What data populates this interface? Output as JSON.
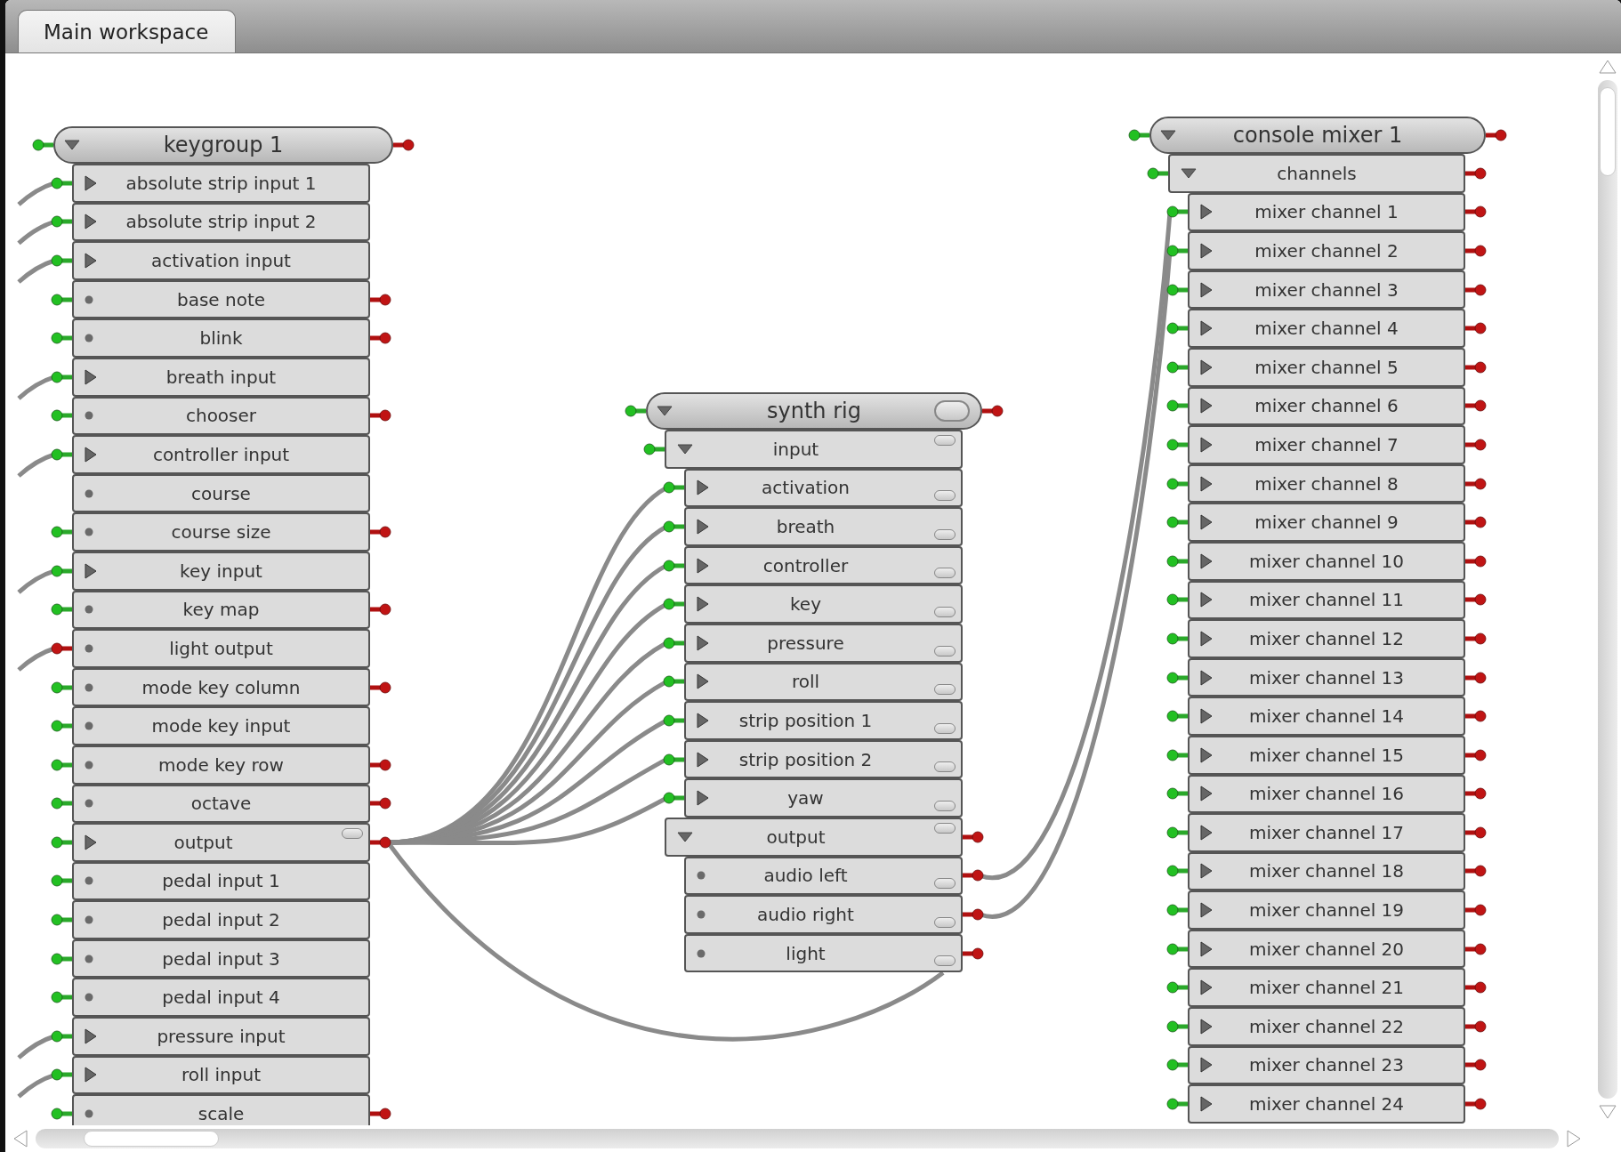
{
  "tabs": [
    {
      "label": "Main workspace",
      "selected": true
    }
  ],
  "nodes": [
    {
      "title": "keygroup 1",
      "expanded": true,
      "left_port": true,
      "right_port": true,
      "toggle_button": false,
      "rows": [
        {
          "label": "absolute strip input 1",
          "kind": "expander",
          "left_port": true,
          "left_port_red": false,
          "wired_in": true,
          "right_port": false,
          "toggle_button": false
        },
        {
          "label": "absolute strip input 2",
          "kind": "expander",
          "left_port": true,
          "left_port_red": false,
          "wired_in": true,
          "right_port": false,
          "toggle_button": false
        },
        {
          "label": "activation input",
          "kind": "expander",
          "left_port": true,
          "left_port_red": false,
          "wired_in": true,
          "right_port": false,
          "toggle_button": false
        },
        {
          "label": "base note",
          "kind": "leaf",
          "left_port": true,
          "left_port_red": false,
          "wired_in": false,
          "right_port": true,
          "wired_out": false,
          "toggle_button": false
        },
        {
          "label": "blink",
          "kind": "leaf",
          "left_port": true,
          "left_port_red": false,
          "wired_in": false,
          "right_port": true,
          "wired_out": false,
          "toggle_button": false
        },
        {
          "label": "breath input",
          "kind": "expander",
          "left_port": true,
          "left_port_red": false,
          "wired_in": true,
          "right_port": false,
          "toggle_button": false
        },
        {
          "label": "chooser",
          "kind": "leaf",
          "left_port": true,
          "left_port_red": false,
          "wired_in": false,
          "right_port": true,
          "wired_out": false,
          "toggle_button": false
        },
        {
          "label": "controller input",
          "kind": "expander",
          "left_port": true,
          "left_port_red": false,
          "wired_in": true,
          "right_port": false,
          "toggle_button": false
        },
        {
          "label": "course",
          "kind": "leaf",
          "left_port": false,
          "right_port": false,
          "toggle_button": false
        },
        {
          "label": "course size",
          "kind": "leaf",
          "left_port": true,
          "left_port_red": false,
          "wired_in": false,
          "right_port": true,
          "wired_out": false,
          "toggle_button": false
        },
        {
          "label": "key input",
          "kind": "expander",
          "left_port": true,
          "left_port_red": false,
          "wired_in": true,
          "right_port": false,
          "toggle_button": false
        },
        {
          "label": "key map",
          "kind": "leaf",
          "left_port": true,
          "left_port_red": false,
          "wired_in": false,
          "right_port": true,
          "wired_out": false,
          "toggle_button": false
        },
        {
          "label": "light output",
          "kind": "leaf",
          "left_port": true,
          "left_port_red": true,
          "wired_in": true,
          "right_port": false,
          "toggle_button": false
        },
        {
          "label": "mode key column",
          "kind": "leaf",
          "left_port": true,
          "left_port_red": false,
          "wired_in": false,
          "right_port": true,
          "wired_out": false,
          "toggle_button": false
        },
        {
          "label": "mode key input",
          "kind": "leaf",
          "left_port": true,
          "left_port_red": false,
          "wired_in": false,
          "right_port": false,
          "toggle_button": false
        },
        {
          "label": "mode key row",
          "kind": "leaf",
          "left_port": true,
          "left_port_red": false,
          "wired_in": false,
          "right_port": true,
          "wired_out": false,
          "toggle_button": false
        },
        {
          "label": "octave",
          "kind": "leaf",
          "left_port": true,
          "left_port_red": false,
          "wired_in": false,
          "right_port": true,
          "wired_out": false,
          "toggle_button": false
        },
        {
          "label": "output",
          "kind": "expander",
          "left_port": true,
          "left_port_red": false,
          "wired_in": false,
          "right_port": true,
          "wired_out": true,
          "toggle_button": true
        },
        {
          "label": "pedal input 1",
          "kind": "leaf",
          "left_port": true,
          "left_port_red": false,
          "wired_in": false,
          "right_port": false,
          "toggle_button": false
        },
        {
          "label": "pedal input 2",
          "kind": "leaf",
          "left_port": true,
          "left_port_red": false,
          "wired_in": false,
          "right_port": false,
          "toggle_button": false
        },
        {
          "label": "pedal input 3",
          "kind": "leaf",
          "left_port": true,
          "left_port_red": false,
          "wired_in": false,
          "right_port": false,
          "toggle_button": false
        },
        {
          "label": "pedal input 4",
          "kind": "leaf",
          "left_port": true,
          "left_port_red": false,
          "wired_in": false,
          "right_port": false,
          "toggle_button": false
        },
        {
          "label": "pressure input",
          "kind": "expander",
          "left_port": true,
          "left_port_red": false,
          "wired_in": true,
          "right_port": false,
          "toggle_button": false
        },
        {
          "label": "roll input",
          "kind": "expander",
          "left_port": true,
          "left_port_red": false,
          "wired_in": true,
          "right_port": false,
          "toggle_button": false
        },
        {
          "label": "scale",
          "kind": "leaf",
          "left_port": true,
          "left_port_red": false,
          "wired_in": false,
          "right_port": true,
          "wired_out": false,
          "toggle_button": false
        }
      ]
    },
    {
      "title": "synth rig",
      "expanded": true,
      "left_port": true,
      "right_port": true,
      "toggle_button": true,
      "rows": [
        {
          "label": "input",
          "kind": "group",
          "left_port": true,
          "left_port_red": false,
          "wired_in": false,
          "right_port": false,
          "toggle_button": true,
          "children": [
            {
              "label": "activation",
              "kind": "expander",
              "left_port": true,
              "left_port_red": false,
              "wired_in": true,
              "right_port": false,
              "toggle_button": true
            },
            {
              "label": "breath",
              "kind": "expander",
              "left_port": true,
              "left_port_red": false,
              "wired_in": true,
              "right_port": false,
              "toggle_button": true
            },
            {
              "label": "controller",
              "kind": "expander",
              "left_port": true,
              "left_port_red": false,
              "wired_in": true,
              "right_port": false,
              "toggle_button": true
            },
            {
              "label": "key",
              "kind": "expander",
              "left_port": true,
              "left_port_red": false,
              "wired_in": true,
              "right_port": false,
              "toggle_button": true
            },
            {
              "label": "pressure",
              "kind": "expander",
              "left_port": true,
              "left_port_red": false,
              "wired_in": true,
              "right_port": false,
              "toggle_button": true
            },
            {
              "label": "roll",
              "kind": "expander",
              "left_port": true,
              "left_port_red": false,
              "wired_in": true,
              "right_port": false,
              "toggle_button": true
            },
            {
              "label": "strip position 1",
              "kind": "expander",
              "left_port": true,
              "left_port_red": false,
              "wired_in": true,
              "right_port": false,
              "toggle_button": true
            },
            {
              "label": "strip position 2",
              "kind": "expander",
              "left_port": true,
              "left_port_red": false,
              "wired_in": true,
              "right_port": false,
              "toggle_button": true
            },
            {
              "label": "yaw",
              "kind": "expander",
              "left_port": true,
              "left_port_red": false,
              "wired_in": true,
              "right_port": false,
              "toggle_button": true
            }
          ]
        },
        {
          "label": "output",
          "kind": "group",
          "left_port": false,
          "right_port": true,
          "wired_out": false,
          "toggle_button": true,
          "children": [
            {
              "label": "audio left",
              "kind": "leaf",
              "left_port": false,
              "right_port": true,
              "wired_out": true,
              "toggle_button": true
            },
            {
              "label": "audio right",
              "kind": "leaf",
              "left_port": false,
              "right_port": true,
              "wired_out": true,
              "toggle_button": true
            },
            {
              "label": "light",
              "kind": "leaf",
              "left_port": false,
              "right_port": true,
              "wired_out": false,
              "wired_in": true,
              "toggle_button": true
            }
          ]
        }
      ]
    },
    {
      "title": "console mixer 1",
      "expanded": true,
      "left_port": true,
      "right_port": true,
      "toggle_button": false,
      "rows": [
        {
          "label": "channels",
          "kind": "group",
          "left_port": true,
          "left_port_red": false,
          "wired_in": false,
          "right_port": true,
          "wired_out": false,
          "toggle_button": false,
          "children": [
            {
              "label": "mixer channel 1",
              "kind": "expander",
              "left_port": true,
              "left_port_red": false,
              "wired_in": true,
              "right_port": true,
              "wired_out": false,
              "toggle_button": false
            },
            {
              "label": "mixer channel 2",
              "kind": "expander",
              "left_port": true,
              "left_port_red": false,
              "wired_in": true,
              "right_port": true,
              "wired_out": false,
              "toggle_button": false
            },
            {
              "label": "mixer channel 3",
              "kind": "expander",
              "left_port": true,
              "left_port_red": false,
              "wired_in": false,
              "right_port": true,
              "wired_out": false,
              "toggle_button": false
            },
            {
              "label": "mixer channel 4",
              "kind": "expander",
              "left_port": true,
              "left_port_red": false,
              "wired_in": false,
              "right_port": true,
              "wired_out": false,
              "toggle_button": false
            },
            {
              "label": "mixer channel 5",
              "kind": "expander",
              "left_port": true,
              "left_port_red": false,
              "wired_in": false,
              "right_port": true,
              "wired_out": false,
              "toggle_button": false
            },
            {
              "label": "mixer channel 6",
              "kind": "expander",
              "left_port": true,
              "left_port_red": false,
              "wired_in": false,
              "right_port": true,
              "wired_out": false,
              "toggle_button": false
            },
            {
              "label": "mixer channel 7",
              "kind": "expander",
              "left_port": true,
              "left_port_red": false,
              "wired_in": false,
              "right_port": true,
              "wired_out": false,
              "toggle_button": false
            },
            {
              "label": "mixer channel 8",
              "kind": "expander",
              "left_port": true,
              "left_port_red": false,
              "wired_in": false,
              "right_port": true,
              "wired_out": false,
              "toggle_button": false
            },
            {
              "label": "mixer channel 9",
              "kind": "expander",
              "left_port": true,
              "left_port_red": false,
              "wired_in": false,
              "right_port": true,
              "wired_out": false,
              "toggle_button": false
            },
            {
              "label": "mixer channel 10",
              "kind": "expander",
              "left_port": true,
              "left_port_red": false,
              "wired_in": false,
              "right_port": true,
              "wired_out": false,
              "toggle_button": false
            },
            {
              "label": "mixer channel 11",
              "kind": "expander",
              "left_port": true,
              "left_port_red": false,
              "wired_in": false,
              "right_port": true,
              "wired_out": false,
              "toggle_button": false
            },
            {
              "label": "mixer channel 12",
              "kind": "expander",
              "left_port": true,
              "left_port_red": false,
              "wired_in": false,
              "right_port": true,
              "wired_out": false,
              "toggle_button": false
            },
            {
              "label": "mixer channel 13",
              "kind": "expander",
              "left_port": true,
              "left_port_red": false,
              "wired_in": false,
              "right_port": true,
              "wired_out": false,
              "toggle_button": false
            },
            {
              "label": "mixer channel 14",
              "kind": "expander",
              "left_port": true,
              "left_port_red": false,
              "wired_in": false,
              "right_port": true,
              "wired_out": false,
              "toggle_button": false
            },
            {
              "label": "mixer channel 15",
              "kind": "expander",
              "left_port": true,
              "left_port_red": false,
              "wired_in": false,
              "right_port": true,
              "wired_out": false,
              "toggle_button": false
            },
            {
              "label": "mixer channel 16",
              "kind": "expander",
              "left_port": true,
              "left_port_red": false,
              "wired_in": false,
              "right_port": true,
              "wired_out": false,
              "toggle_button": false
            },
            {
              "label": "mixer channel 17",
              "kind": "expander",
              "left_port": true,
              "left_port_red": false,
              "wired_in": false,
              "right_port": true,
              "wired_out": false,
              "toggle_button": false
            },
            {
              "label": "mixer channel 18",
              "kind": "expander",
              "left_port": true,
              "left_port_red": false,
              "wired_in": false,
              "right_port": true,
              "wired_out": false,
              "toggle_button": false
            },
            {
              "label": "mixer channel 19",
              "kind": "expander",
              "left_port": true,
              "left_port_red": false,
              "wired_in": false,
              "right_port": true,
              "wired_out": false,
              "toggle_button": false
            },
            {
              "label": "mixer channel 20",
              "kind": "expander",
              "left_port": true,
              "left_port_red": false,
              "wired_in": false,
              "right_port": true,
              "wired_out": false,
              "toggle_button": false
            },
            {
              "label": "mixer channel 21",
              "kind": "expander",
              "left_port": true,
              "left_port_red": false,
              "wired_in": false,
              "right_port": true,
              "wired_out": false,
              "toggle_button": false
            },
            {
              "label": "mixer channel 22",
              "kind": "expander",
              "left_port": true,
              "left_port_red": false,
              "wired_in": false,
              "right_port": true,
              "wired_out": false,
              "toggle_button": false
            },
            {
              "label": "mixer channel 23",
              "kind": "expander",
              "left_port": true,
              "left_port_red": false,
              "wired_in": false,
              "right_port": true,
              "wired_out": false,
              "toggle_button": false
            },
            {
              "label": "mixer channel 24",
              "kind": "expander",
              "left_port": true,
              "left_port_red": false,
              "wired_in": false,
              "right_port": true,
              "wired_out": false,
              "toggle_button": false
            }
          ]
        }
      ]
    }
  ]
}
